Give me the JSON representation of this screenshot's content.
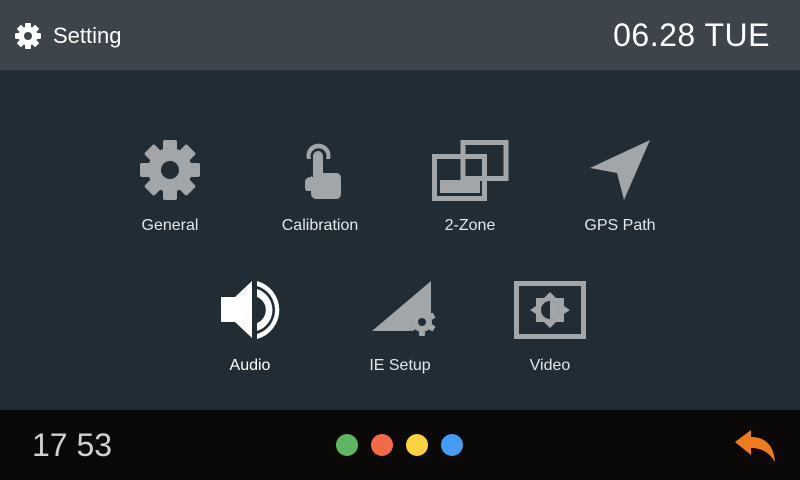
{
  "header": {
    "title": "Setting",
    "title_icon": "gear-icon",
    "date": "06.28 TUE"
  },
  "menu": {
    "items": [
      {
        "id": "general",
        "label": "General",
        "icon": "gear-icon",
        "active": false
      },
      {
        "id": "calibration",
        "label": "Calibration",
        "icon": "touch-hand-icon",
        "active": false
      },
      {
        "id": "2zone",
        "label": "2-Zone",
        "icon": "dual-screen-icon",
        "active": false
      },
      {
        "id": "gps",
        "label": "GPS Path",
        "icon": "navigation-arrow-icon",
        "active": false
      },
      {
        "id": "audio",
        "label": "Audio",
        "icon": "speaker-icon",
        "active": true
      },
      {
        "id": "ie",
        "label": "IE Setup",
        "icon": "signal-gear-icon",
        "active": false
      },
      {
        "id": "video",
        "label": "Video",
        "icon": "brightness-icon",
        "active": false
      }
    ]
  },
  "footer": {
    "time": "17 53",
    "dots": [
      {
        "name": "green-dot",
        "color": "#5fb562"
      },
      {
        "name": "orange-dot",
        "color": "#f36b46"
      },
      {
        "name": "yellow-dot",
        "color": "#f9d43c"
      },
      {
        "name": "blue-dot",
        "color": "#449cf4"
      }
    ],
    "back_icon": "back-arrow-icon",
    "back_color": "#ef7b1c"
  },
  "colors": {
    "header_bg": "#3d444c",
    "body_bg": "#212c35",
    "footer_bg": "#0a0908",
    "icon_inactive": "#a3a6a9",
    "icon_active": "#ffffff"
  }
}
